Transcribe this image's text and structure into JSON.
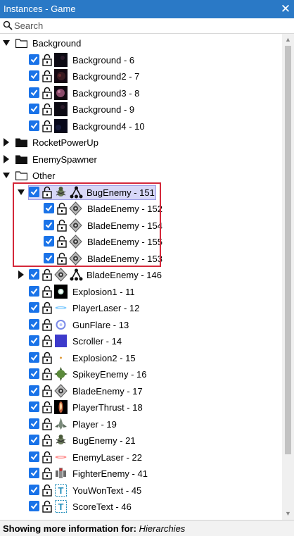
{
  "window": {
    "title": "Instances - Game",
    "close_glyph": "✕"
  },
  "search": {
    "placeholder": "Search"
  },
  "tree": [
    {
      "label": "Background",
      "kind": "folder",
      "expander": "expanded",
      "level": 0
    },
    {
      "label": "Background - 6",
      "kind": "item",
      "level": 1,
      "thumb": "bg-dark"
    },
    {
      "label": "Background2 - 7",
      "kind": "item",
      "level": 1,
      "thumb": "bg-nebula"
    },
    {
      "label": "Background3 - 8",
      "kind": "item",
      "level": 1,
      "thumb": "bg-planet"
    },
    {
      "label": "Background - 9",
      "kind": "item",
      "level": 1,
      "thumb": "bg-dark"
    },
    {
      "label": "Background4 - 10",
      "kind": "item",
      "level": 1,
      "thumb": "bg-dark2"
    },
    {
      "label": "RocketPowerUp",
      "kind": "folder",
      "expander": "collapsed",
      "level": 0,
      "filled": true
    },
    {
      "label": "EnemySpawner",
      "kind": "folder",
      "expander": "collapsed",
      "level": 0,
      "filled": true
    },
    {
      "label": "Other",
      "kind": "folder",
      "expander": "expanded",
      "level": 0
    },
    {
      "label": "BugEnemy - 151",
      "kind": "item",
      "level": 1,
      "thumb": "bug",
      "hierarchy": true,
      "expander": "expanded",
      "selected": true
    },
    {
      "label": "BladeEnemy - 152",
      "kind": "item",
      "level": 2,
      "thumb": "blade"
    },
    {
      "label": "BladeEnemy - 154",
      "kind": "item",
      "level": 2,
      "thumb": "blade"
    },
    {
      "label": "BladeEnemy - 155",
      "kind": "item",
      "level": 2,
      "thumb": "blade"
    },
    {
      "label": "BladeEnemy - 153",
      "kind": "item",
      "level": 2,
      "thumb": "blade"
    },
    {
      "label": "BladeEnemy - 146",
      "kind": "item",
      "level": 1,
      "thumb": "blade",
      "hierarchy": true,
      "expander": "collapsed"
    },
    {
      "label": "Explosion1 - 11",
      "kind": "item",
      "level": 1,
      "thumb": "explosion"
    },
    {
      "label": "PlayerLaser - 12",
      "kind": "item",
      "level": 1,
      "thumb": "laser-blue"
    },
    {
      "label": "GunFlare - 13",
      "kind": "item",
      "level": 1,
      "thumb": "flare"
    },
    {
      "label": "Scroller - 14",
      "kind": "item",
      "level": 1,
      "thumb": "scroller"
    },
    {
      "label": "Explosion2 - 15",
      "kind": "item",
      "level": 1,
      "thumb": "spark"
    },
    {
      "label": "SpikeyEnemy - 16",
      "kind": "item",
      "level": 1,
      "thumb": "spikey"
    },
    {
      "label": "BladeEnemy - 17",
      "kind": "item",
      "level": 1,
      "thumb": "blade"
    },
    {
      "label": "PlayerThrust - 18",
      "kind": "item",
      "level": 1,
      "thumb": "thrust"
    },
    {
      "label": "Player - 19",
      "kind": "item",
      "level": 1,
      "thumb": "player"
    },
    {
      "label": "BugEnemy - 21",
      "kind": "item",
      "level": 1,
      "thumb": "bug"
    },
    {
      "label": "EnemyLaser - 22",
      "kind": "item",
      "level": 1,
      "thumb": "laser-red"
    },
    {
      "label": "FighterEnemy - 41",
      "kind": "item",
      "level": 1,
      "thumb": "fighter"
    },
    {
      "label": "YouWonText - 45",
      "kind": "item",
      "level": 1,
      "thumb": "text"
    },
    {
      "label": "ScoreText - 46",
      "kind": "item",
      "level": 1,
      "thumb": "text"
    }
  ],
  "footer": {
    "prefix": "Showing more information for:",
    "value": "Hierarchies"
  },
  "colors": {
    "titlebar": "#2a79c6",
    "checkbox": "#1a73e8",
    "selection": "#d7d7f7",
    "highlight": "#d4283a"
  }
}
